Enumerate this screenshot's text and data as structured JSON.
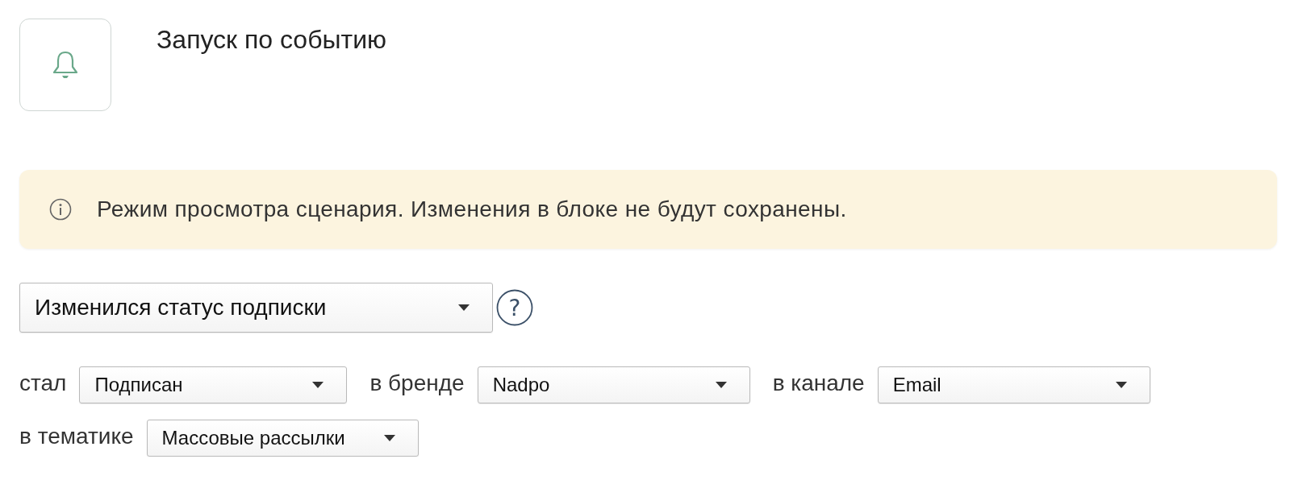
{
  "trigger": {
    "title": "Запуск по событию"
  },
  "notice": {
    "text": "Режим просмотра сценария. Изменения в блоке не будут сохранены."
  },
  "event_select": {
    "value": "Изменился статус подписки",
    "help": "?"
  },
  "conditions": [
    {
      "label": "стал",
      "value": "Подписан"
    },
    {
      "label": "в бренде",
      "value": "Nadpo"
    },
    {
      "label": "в канале",
      "value": "Email"
    },
    {
      "label": "в тематике",
      "value": "Массовые рассылки"
    }
  ]
}
